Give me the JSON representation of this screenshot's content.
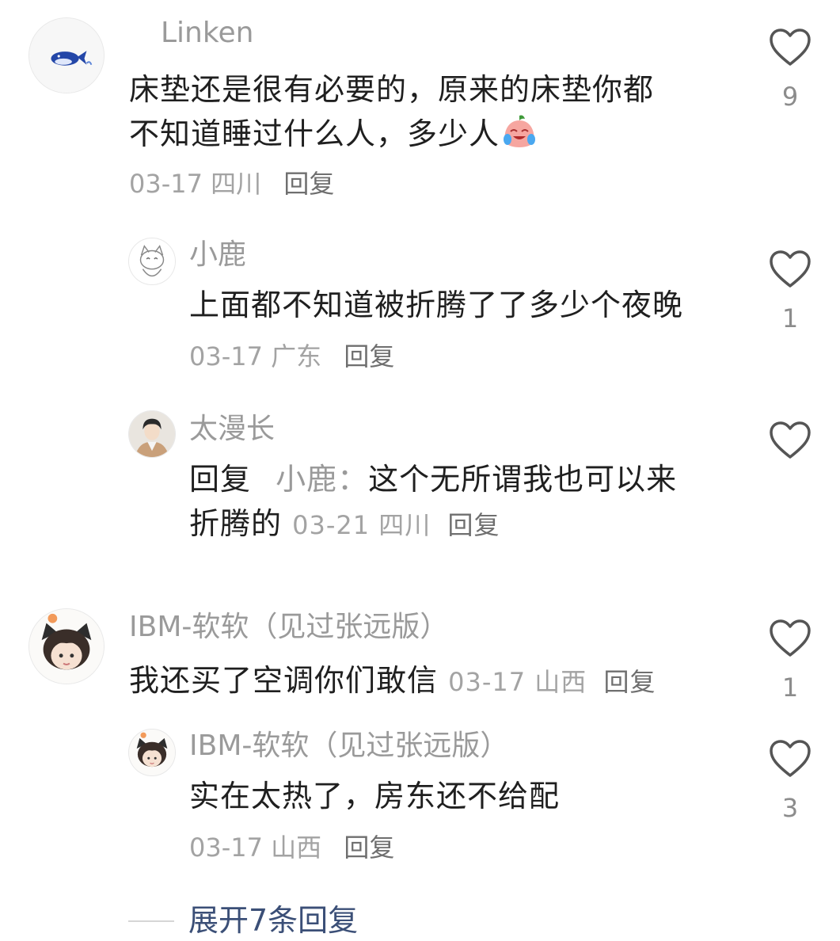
{
  "comments": [
    {
      "name": "Linken",
      "text_line1": "床垫还是很有必要的，原来的床垫你都",
      "text_line2": "不知道睡过什么人，多少人",
      "date": "03-17",
      "location": "四川",
      "reply": "回复",
      "likes": "9",
      "avatar": "whale-avatar",
      "emoji": "crying-laughing-peach-emoji"
    },
    {
      "name": "小鹿",
      "text_line1": "上面都不知道被折腾了了多少个夜晚",
      "date": "03-17",
      "location": "广东",
      "reply": "回复",
      "likes": "1",
      "avatar": "cartoon-cat-avatar"
    },
    {
      "name": "太漫长",
      "reply_prefix": "回复",
      "reply_to": "小鹿",
      "colon": "：",
      "text_line1": "这个无所谓我也可以来",
      "text_line2": "折腾的",
      "date": "03-21",
      "location": "四川",
      "reply": "回复",
      "likes": "",
      "avatar": "anime-boy-avatar"
    },
    {
      "name": "IBM-软软（见过张远版）",
      "text_line1": "我还买了空调你们敢信",
      "date": "03-17",
      "location": "山西",
      "reply": "回复",
      "likes": "1",
      "avatar": "cat-ear-boy-avatar"
    },
    {
      "name": "IBM-软软（见过张远版）",
      "text_line1": "实在太热了，房东还不给配",
      "date": "03-17",
      "location": "山西",
      "reply": "回复",
      "likes": "3",
      "avatar": "cat-ear-boy-avatar"
    }
  ],
  "expand": {
    "label": "展开7条回复"
  },
  "colors": {
    "link": "#3b4f77",
    "meta": "#a3a3a3",
    "text": "#1f1f1f"
  }
}
